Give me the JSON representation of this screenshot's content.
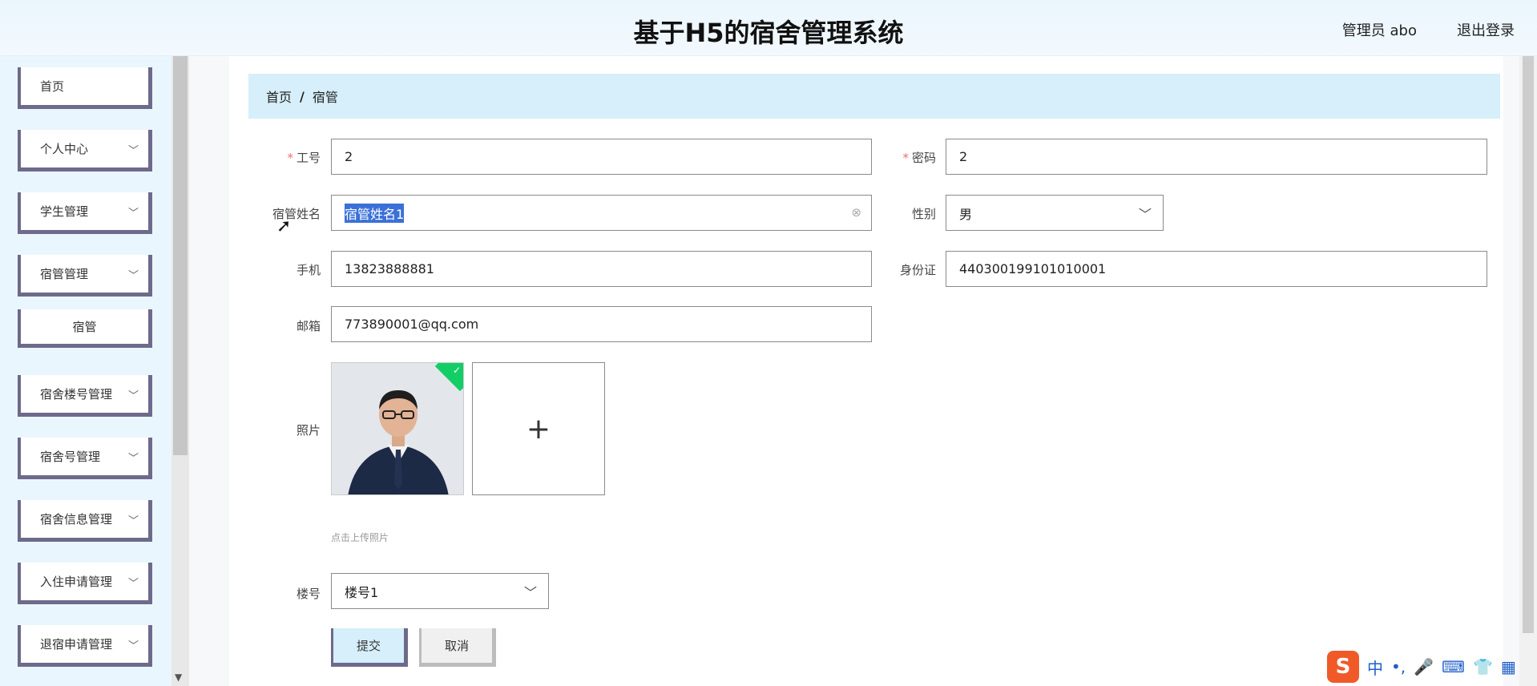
{
  "header": {
    "title": "基于H5的宿舍管理系统",
    "user": "管理员 abo",
    "logout": "退出登录"
  },
  "sidebar": {
    "items": [
      {
        "label": "首页",
        "expandable": false
      },
      {
        "label": "个人中心",
        "expandable": true
      },
      {
        "label": "学生管理",
        "expandable": true
      },
      {
        "label": "宿管管理",
        "expandable": true
      },
      {
        "label": "宿管",
        "expandable": false,
        "submenu": true
      },
      {
        "label": "宿舍楼号管理",
        "expandable": true
      },
      {
        "label": "宿舍号管理",
        "expandable": true
      },
      {
        "label": "宿舍信息管理",
        "expandable": true
      },
      {
        "label": "入住申请管理",
        "expandable": true
      },
      {
        "label": "退宿申请管理",
        "expandable": true
      }
    ],
    "chevron_icon": "chevron-down-icon"
  },
  "breadcrumb": {
    "home": "首页",
    "separator": "/",
    "current": "宿管"
  },
  "form": {
    "gonghao": {
      "label": "工号",
      "value": "2",
      "required": true
    },
    "mima": {
      "label": "密码",
      "value": "2",
      "required": true
    },
    "xingming": {
      "label": "宿管姓名",
      "value": "宿管姓名1"
    },
    "xingbie": {
      "label": "性别",
      "value": "男"
    },
    "shouji": {
      "label": "手机",
      "value": "13823888881"
    },
    "shenfenzheng": {
      "label": "身份证",
      "value": "440300199101010001"
    },
    "youxiang": {
      "label": "邮箱",
      "value": "773890001@qq.com"
    },
    "zhaopian": {
      "label": "照片",
      "hint": "点击上传照片"
    },
    "louhao": {
      "label": "楼号",
      "value": "楼号1"
    }
  },
  "buttons": {
    "submit": "提交",
    "cancel": "取消"
  },
  "ime": {
    "logo": "S",
    "lang": "中",
    "punct": "•,"
  },
  "colors": {
    "header_bg": "#eaf6fd",
    "breadcrumb_bg": "#d6effa",
    "menu_border": "#6d6a8c",
    "required": "#f56c6c",
    "upload_ok": "#13ce66",
    "selection": "#3b70d8"
  }
}
